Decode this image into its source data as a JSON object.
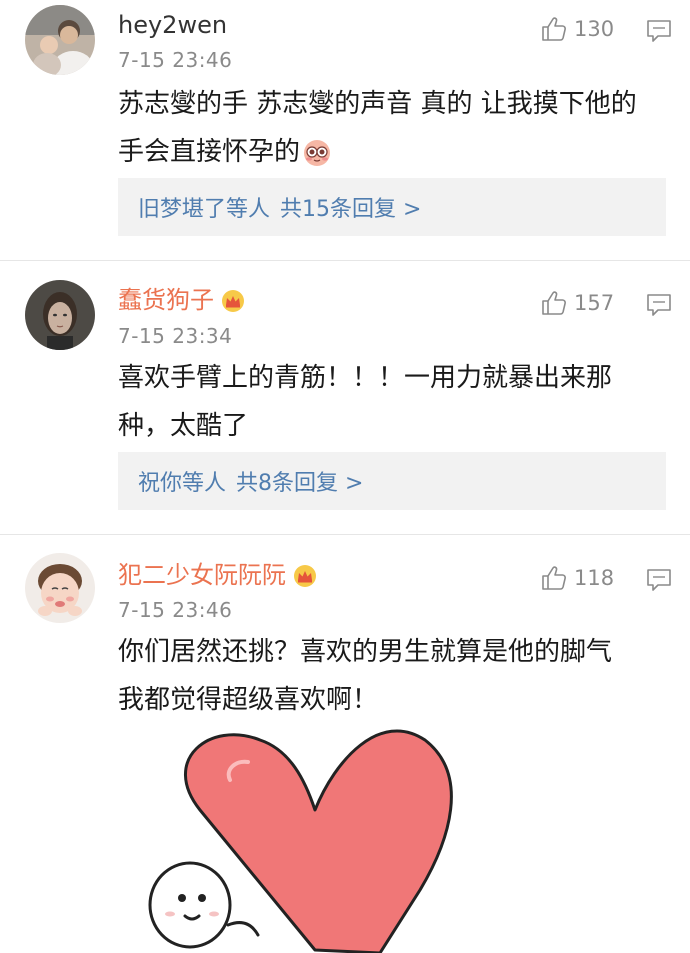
{
  "comments": [
    {
      "username": "hey2wen",
      "time": "7-15 23:46",
      "likes": "130",
      "text_line1": "苏志燮的手 苏志燮的声音 真的 让我摸下他的",
      "text_line2": "手会直接怀孕的",
      "reply_names": "旧梦堪了等人",
      "reply_count": "共15条回复 >"
    },
    {
      "username": "蠢货狗子",
      "time": "7-15 23:34",
      "likes": "157",
      "text_line1": "喜欢手臂上的青筋！！！一用力就暴出来那",
      "text_line2": "种，太酷了",
      "reply_names": "祝你等人",
      "reply_count": "共8条回复 >"
    },
    {
      "username": "犯二少女阮阮阮",
      "time": "7-15 23:46",
      "likes": "118",
      "text_line1": "你们居然还挑？喜欢的男生就算是他的脚气",
      "text_line2": "我都觉得超级喜欢啊！"
    }
  ],
  "colors": {
    "vip_name": "#eb7350",
    "reply_link": "#507daf",
    "meta_gray": "#8a8a8a",
    "heart": "#f07777"
  },
  "icons": [
    "thumbs-up-icon",
    "comment-icon",
    "crown-icon",
    "blush-emoji",
    "heart-sticker"
  ]
}
